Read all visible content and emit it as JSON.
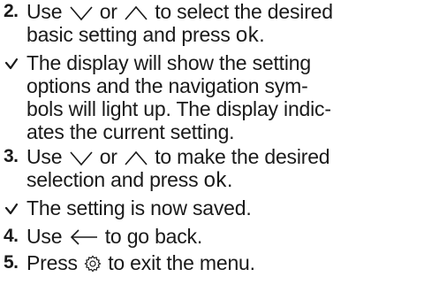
{
  "steps": [
    {
      "marker": "2.",
      "text_use": "Use",
      "icon_down": "chevron-down-icon",
      "text_or": "or",
      "icon_up": "chevron-up-icon",
      "text_to_select": "to select the desired",
      "text_line2": "basic setting and press",
      "ok_label": "ok",
      "period": "."
    },
    {
      "result_icon": "check-icon",
      "lines": [
        "The display will show the setting",
        "options and the navigation sym-",
        "bols will light up. The display indic-",
        "ates the current setting."
      ]
    },
    {
      "marker": "3.",
      "text_use": "Use",
      "icon_down": "chevron-down-icon",
      "text_or": "or",
      "icon_up": "chevron-up-icon",
      "text_to_make": "to make the desired",
      "text_line2": "selection and press",
      "ok_label": "ok",
      "period": "."
    },
    {
      "result_icon": "check-icon",
      "lines": [
        "The setting is now saved."
      ]
    },
    {
      "marker": "4.",
      "text_use": "Use",
      "icon_back": "arrow-left-icon",
      "text_rest": "to go back."
    },
    {
      "marker": "5.",
      "text_press": "Press",
      "icon_settings": "gear-icon",
      "text_rest": "to exit the menu."
    }
  ]
}
